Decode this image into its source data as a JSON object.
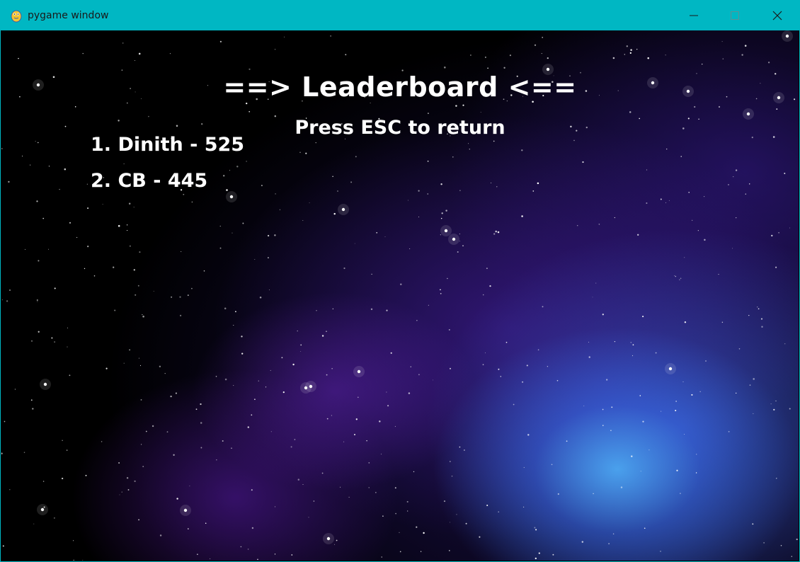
{
  "window": {
    "title": "pygame window",
    "icon": "pygame-snake-icon",
    "controls": [
      "minimize-icon",
      "maximize-icon",
      "close-icon"
    ],
    "accent_color": "#00b7c3"
  },
  "screen": {
    "heading": "==> Leaderboard <==",
    "subheading": "Press ESC to return",
    "entries": [
      {
        "text": "1. Dinith - 525"
      },
      {
        "text": "2. CB - 445"
      }
    ],
    "text_color": "#ffffff",
    "background": "starfield-nebula"
  }
}
